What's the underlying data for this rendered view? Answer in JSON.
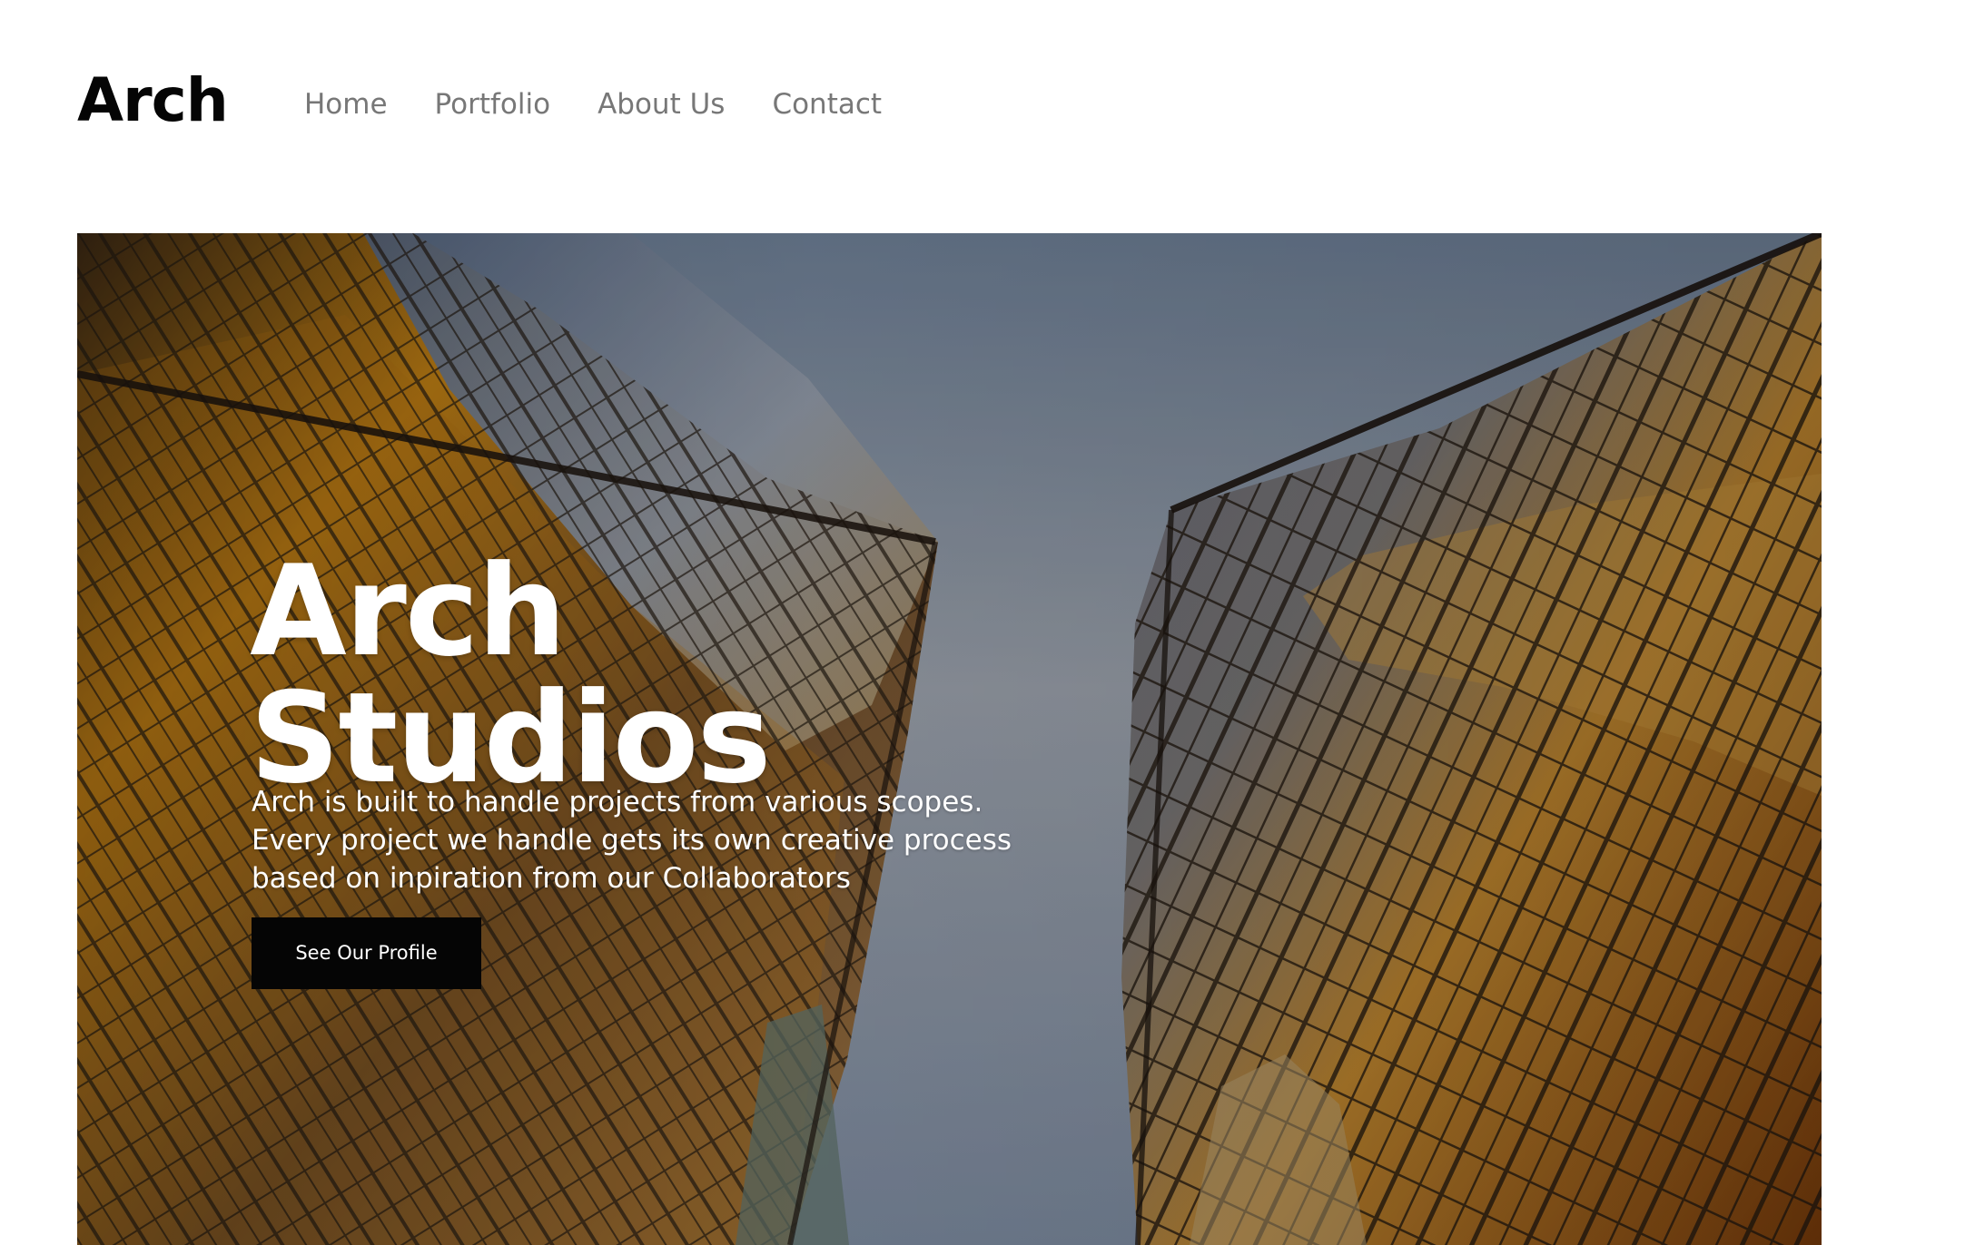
{
  "brand": {
    "logo": "Arch"
  },
  "nav": {
    "items": [
      {
        "label": "Home"
      },
      {
        "label": "Portfolio"
      },
      {
        "label": "About Us"
      },
      {
        "label": "Contact"
      }
    ]
  },
  "hero": {
    "title_line_1": "Arch",
    "title_line_2": "Studios",
    "description_lines": [
      "Arch is built to handle projects from various scopes.",
      "Every project we handle gets its own creative process",
      "based on inpiration from our Collaborators"
    ],
    "button_label": "See Our Profile"
  },
  "colors": {
    "text_dark": "#050505",
    "nav_text": "#777777",
    "hero_text": "#ffffff",
    "button_background": "#050505",
    "sky": "#8c98a9",
    "glass_gold": "#b97814",
    "frame": "#241a13"
  }
}
